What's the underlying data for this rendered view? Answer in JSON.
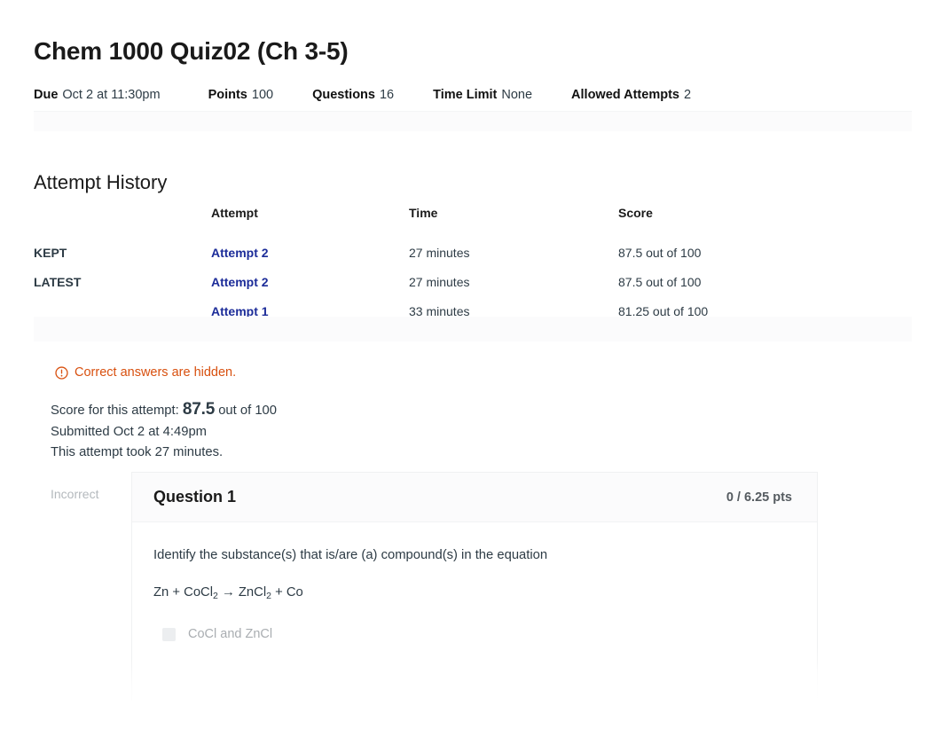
{
  "quiz": {
    "title": "Chem 1000 Quiz02 (Ch 3-5)"
  },
  "meta": {
    "due_label": "Due",
    "due_value": "Oct 2 at 11:30pm",
    "points_label": "Points",
    "points_value": "100",
    "questions_label": "Questions",
    "questions_value": "16",
    "time_limit_label": "Time Limit",
    "time_limit_value": "None",
    "allowed_attempts_label": "Allowed Attempts",
    "allowed_attempts_value": "2"
  },
  "attempt_history": {
    "section_title": "Attempt History",
    "columns": {
      "status": "",
      "attempt": "Attempt",
      "time": "Time",
      "score": "Score"
    },
    "rows": [
      {
        "status": "KEPT",
        "attempt": "Attempt 2",
        "time": "27 minutes",
        "score": "87.5 out of 100"
      },
      {
        "status": "LATEST",
        "attempt": "Attempt 2",
        "time": "27 minutes",
        "score": "87.5 out of 100"
      },
      {
        "status": "",
        "attempt": "Attempt 1",
        "time": "33 minutes",
        "score": "81.25 out of 100"
      }
    ]
  },
  "notice": {
    "icon": "exclamation-circle-icon",
    "text": "Correct answers are hidden.",
    "color": "#d8500f"
  },
  "attempt_summary": {
    "score_prefix": "Score for this attempt:",
    "score_value": "87.5",
    "score_suffix": "out of 100",
    "submitted": "Submitted Oct 2 at 4:49pm",
    "duration": "This attempt took 27 minutes."
  },
  "question": {
    "status": "Incorrect",
    "title": "Question 1",
    "points": "0 / 6.25 pts",
    "prompt": "Identify the substance(s) that is/are (a) compound(s) in the equation",
    "equation_parts": [
      {
        "t": "Zn + CoCl"
      },
      {
        "sub": "2"
      },
      {
        "t": " → ZnCl"
      },
      {
        "sub": "2"
      },
      {
        "t": " + Co"
      }
    ],
    "equation_plain": "Zn + CoCl2 → ZnCl2 + Co",
    "answers": [
      {
        "text": "CoCl   and ZnCl",
        "selected": false
      }
    ]
  },
  "colors": {
    "link": "#1c2c99",
    "warning": "#d8500f",
    "text": "#2d3b45",
    "muted": "#b4b9bd",
    "band": "#fbfbfc"
  }
}
